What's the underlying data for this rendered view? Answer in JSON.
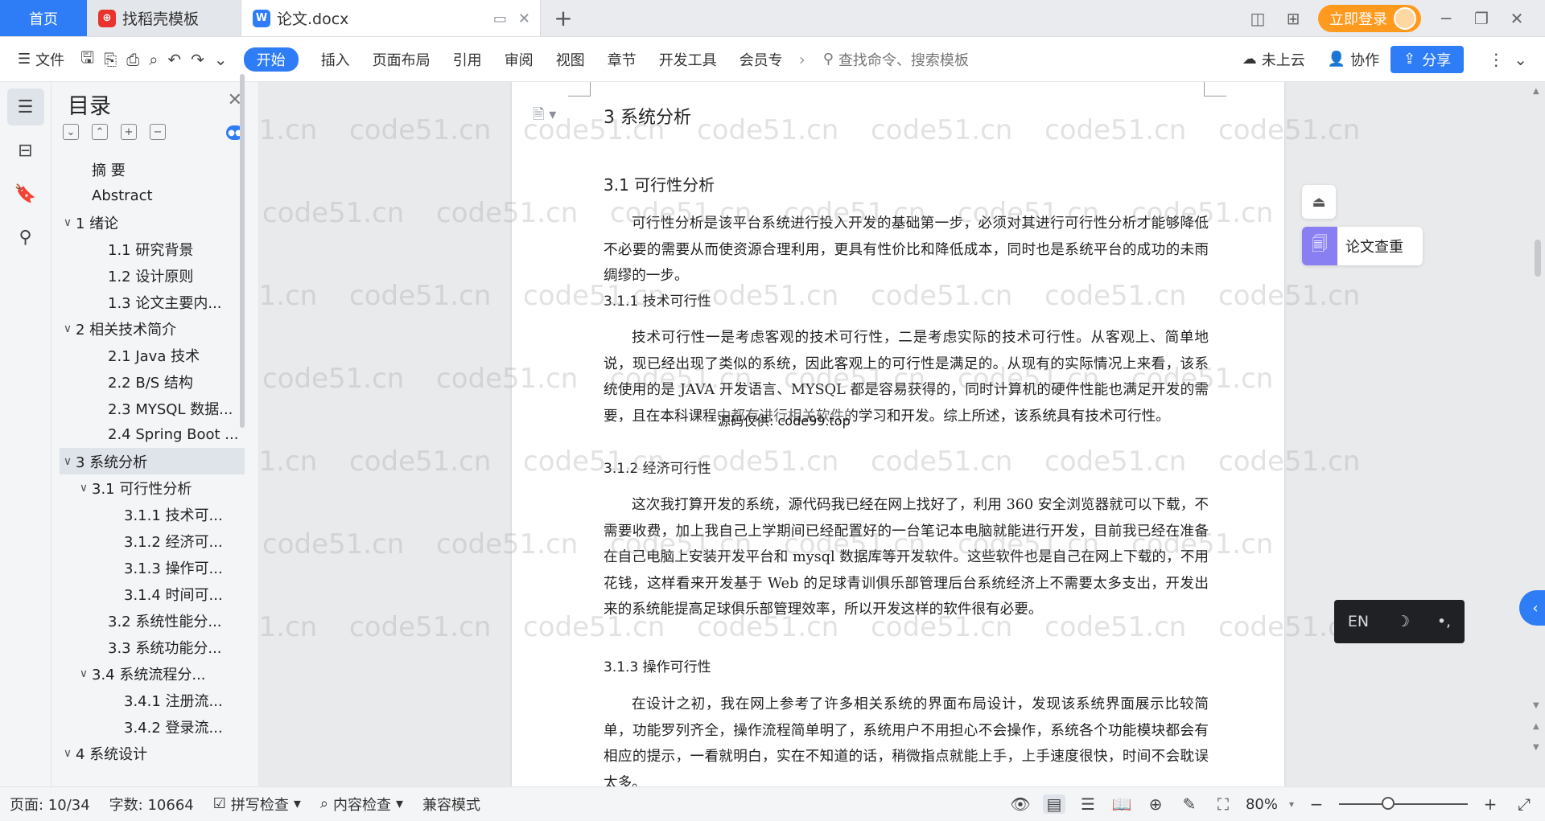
{
  "tabs": {
    "home_label": "首页",
    "template_label": "找稻壳模板",
    "doc_label": "论文.docx",
    "doc_badge": "W",
    "template_badge": "⊕"
  },
  "tabbar_right": {
    "login_label": "立即登录"
  },
  "ribbon": {
    "file_label": "文件",
    "active_tab": "开始",
    "tabs": [
      "插入",
      "页面布局",
      "引用",
      "审阅",
      "视图",
      "章节",
      "开发工具",
      "会员专"
    ],
    "search_placeholder": "查找命令、搜索模板",
    "cloud_label": "未上云",
    "collab_label": "协作",
    "share_label": "分享"
  },
  "toc": {
    "title": "目录",
    "items": [
      {
        "label": "摘  要",
        "indent": 1,
        "chevron": ""
      },
      {
        "label": "Abstract",
        "indent": 1,
        "chevron": ""
      },
      {
        "label": "1  绪论",
        "indent": 0,
        "chevron": "∨"
      },
      {
        "label": "1.1 研究背景",
        "indent": 2,
        "chevron": ""
      },
      {
        "label": "1.2 设计原则",
        "indent": 2,
        "chevron": ""
      },
      {
        "label": "1.3 论文主要内...",
        "indent": 2,
        "chevron": ""
      },
      {
        "label": "2  相关技术简介",
        "indent": 0,
        "chevron": "∨"
      },
      {
        "label": "2.1 Java 技术",
        "indent": 2,
        "chevron": ""
      },
      {
        "label": "2.2 B/S 结构",
        "indent": 2,
        "chevron": ""
      },
      {
        "label": "2.3 MYSQL 数据...",
        "indent": 2,
        "chevron": ""
      },
      {
        "label": "2.4 Spring Boot ...",
        "indent": 2,
        "chevron": ""
      },
      {
        "label": "3  系统分析",
        "indent": 0,
        "chevron": "∨",
        "selected": true
      },
      {
        "label": "3.1  可行性分析",
        "indent": 1,
        "chevron": "∨"
      },
      {
        "label": "3.1.1  技术可...",
        "indent": 3,
        "chevron": ""
      },
      {
        "label": "3.1.2  经济可...",
        "indent": 3,
        "chevron": ""
      },
      {
        "label": "3.1.3  操作可...",
        "indent": 3,
        "chevron": ""
      },
      {
        "label": "3.1.4  时间可...",
        "indent": 3,
        "chevron": ""
      },
      {
        "label": "3.2  系统性能分...",
        "indent": 2,
        "chevron": ""
      },
      {
        "label": "3.3  系统功能分...",
        "indent": 2,
        "chevron": ""
      },
      {
        "label": "3.4  系统流程分...",
        "indent": 1,
        "chevron": "∨"
      },
      {
        "label": "3.4.1 注册流...",
        "indent": 3,
        "chevron": ""
      },
      {
        "label": "3.4.2 登录流...",
        "indent": 3,
        "chevron": ""
      },
      {
        "label": "4  系统设计",
        "indent": 0,
        "chevron": "∨"
      }
    ]
  },
  "document": {
    "h1": "3  系统分析",
    "h2_1": "3.1  可行性分析",
    "p1": "可行性分析是该平台系统进行投入开发的基础第一步，必须对其进行可行性分析才能够降低不必要的需要从而使资源合理利用，更具有性价比和降低成本，同时也是系统平台的成功的未雨绸缪的一步。",
    "h3_1": "3.1.1  技术可行性",
    "p2": "技术可行性一是考虑客观的技术可行性，二是考虑实际的技术可行性。从客观上、简单地说，现已经出现了类似的系统，因此客观上的可行性是满足的。从现有的实际情况上来看，该系统使用的是 JAVA 开发语言、MYSQL 都是容易获得的，同时计算机的硬件性能也满足开发的需要，且在本科课程中都有进行相关软件的学习和开发。综上所述，该系统具有技术可行性。",
    "overlay": "源码仅供: code99.top",
    "h3_2": "3.1.2  经济可行性",
    "p3": "这次我打算开发的系统，源代码我已经在网上找好了，利用 360 安全浏览器就可以下载，不需要收费，加上我自己上学期间已经配置好的一台笔记本电脑就能进行开发，目前我已经在准备在自己电脑上安装开发平台和 mysql 数据库等开发软件。这些软件也是自己在网上下载的，不用花钱，这样看来开发基于 Web 的足球青训俱乐部管理后台系统经济上不需要太多支出，开发出来的系统能提高足球俱乐部管理效率，所以开发这样的软件很有必要。",
    "h3_3": "3.1.3  操作可行性",
    "p4": "在设计之初，我在网上参考了许多相关系统的界面布局设计，发现该系统界面展示比较简单，功能罗列齐全，操作流程简单明了，系统用户不用担心不会操作，系统各个功能模块都会有相应的提示，一看就明白，实在不知道的话，稍微指点就能上手，上手速度很快，时间不会耽误太多。",
    "watermark": "code51.cn"
  },
  "floating": {
    "check_label": "论文查重",
    "ime_lang": "EN",
    "ime_moon": "☽",
    "ime_punct": "•,"
  },
  "status": {
    "page_label": "页面: 10/34",
    "words_label": "字数: 10664",
    "spell_label": "拼写检查",
    "content_label": "内容检查",
    "compat_label": "兼容模式",
    "zoom_label": "80%",
    "zoom_value_percent": 80
  },
  "colors": {
    "accent": "#2f7df6",
    "login": "#ff9a1f",
    "check_icon": "#8a7ef3",
    "ime_bg": "#1f2124"
  }
}
